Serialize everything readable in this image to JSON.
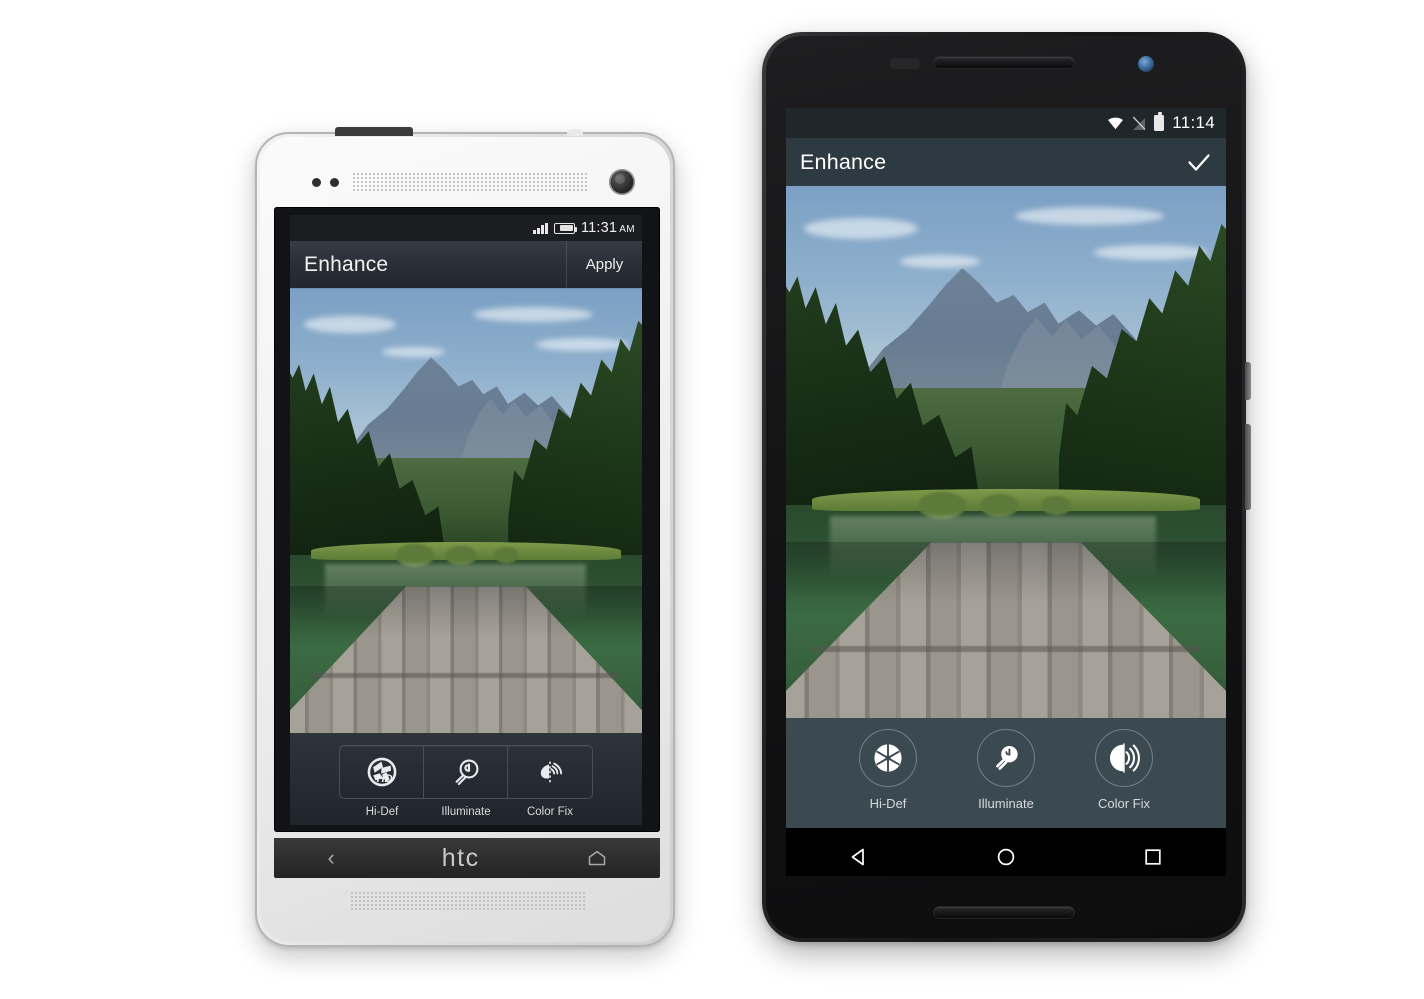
{
  "scene": {
    "description": "Two smartphones side by side showing the Enhance photo-editing screen",
    "photo_subject": "mountain lake with wooden dock"
  },
  "htc_phone": {
    "device_label": "htc",
    "status_bar": {
      "signal_icon": "signal-bars-icon",
      "battery_icon": "battery-icon",
      "time": "11:31",
      "meridiem": "AM"
    },
    "action_bar": {
      "title": "Enhance",
      "action_label": "Apply"
    },
    "toolbar": {
      "tools": [
        {
          "label": "Hi-Def",
          "icon": "aperture-hd-icon"
        },
        {
          "label": "Illuminate",
          "icon": "lightbulb-icon"
        },
        {
          "label": "Color Fix",
          "icon": "color-gauge-icon"
        }
      ]
    },
    "nav_bar": {
      "back_icon": "back-chevron-icon",
      "brand": "htc",
      "home_icon": "home-icon"
    }
  },
  "moto_phone": {
    "status_bar": {
      "wifi_icon": "wifi-icon",
      "no_sim_icon": "no-sim-icon",
      "battery_icon": "battery-icon",
      "time": "11:14"
    },
    "action_bar": {
      "title": "Enhance",
      "confirm_icon": "checkmark-icon"
    },
    "toolbar": {
      "tools": [
        {
          "label": "Hi-Def",
          "icon": "aperture-icon"
        },
        {
          "label": "Illuminate",
          "icon": "lightbulb-icon"
        },
        {
          "label": "Color Fix",
          "icon": "color-waves-icon"
        }
      ]
    },
    "nav_bar": {
      "back_icon": "triangle-back-icon",
      "home_icon": "circle-home-icon",
      "recents_icon": "square-recents-icon"
    }
  },
  "colors": {
    "htc_action_bar": "#2a2e37",
    "htc_toolbar": "#262a32",
    "moto_action_bar": "#2e3a41",
    "moto_toolbar": "#3b4a51",
    "moto_status_bar": "#20272b",
    "accent_underline": "#6a93b8",
    "label_text": "#d3dade"
  }
}
